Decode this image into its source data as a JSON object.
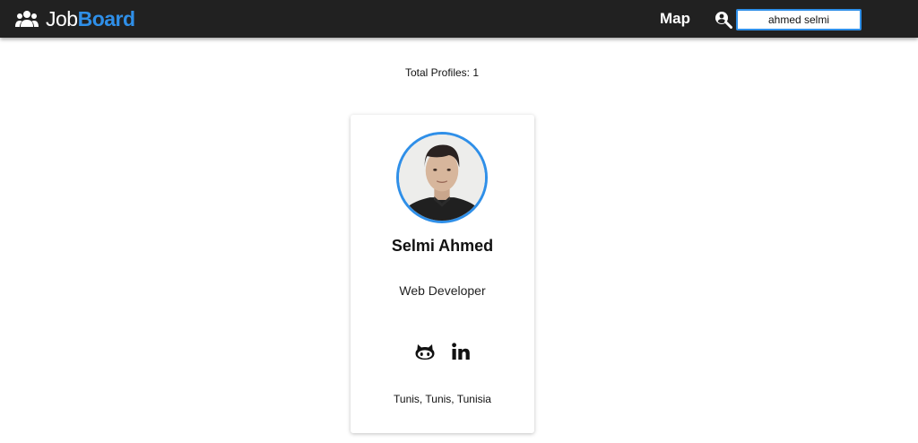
{
  "navbar": {
    "brand": {
      "part1": "Job",
      "part2": "Board",
      "icon": "people-icon"
    },
    "links": [
      {
        "label": "Map"
      }
    ],
    "search": {
      "icon": "search-person-icon",
      "value": "ahmed selmi"
    }
  },
  "results": {
    "total_label": "Total Profiles: 1"
  },
  "profiles": [
    {
      "name": "Selmi Ahmed",
      "title": "Web Developer",
      "location": "Tunis, Tunis, Tunisia",
      "socials": [
        {
          "icon": "github-icon"
        },
        {
          "icon": "linkedin-icon"
        }
      ]
    }
  ],
  "colors": {
    "navbar": "#212121",
    "accent": "#2f8fe8",
    "background": "#ffffff"
  }
}
